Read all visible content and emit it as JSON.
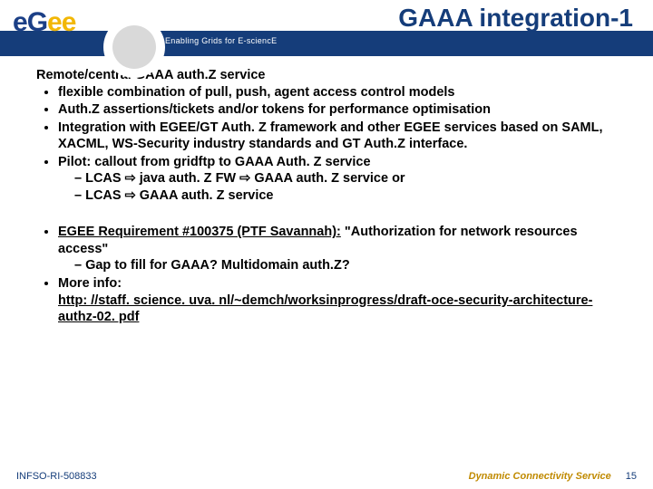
{
  "header": {
    "logo_e1": "e",
    "logo_g": "G",
    "logo_e2": "e",
    "logo_e3": "e",
    "tagline": "Enabling Grids for E-sciencE",
    "title": "GAAA integration-1"
  },
  "body": {
    "heading": "Remote/central GAAA auth.Z service",
    "bullets": [
      {
        "text": "flexible combination of pull, push, agent access control models"
      },
      {
        "text": "Auth.Z assertions/tickets and/or tokens for performance optimisation"
      },
      {
        "text": "Integration with EGEE/GT Auth. Z framework and other EGEE services based on SAML, XACML, WS-Security industry standards and GT Auth.Z interface."
      },
      {
        "lead": "Pilot: ",
        "rest": "callout from gridftp to GAAA Auth. Z service",
        "subs": [
          "LCAS ⇨ java auth. Z FW ⇨ GAAA auth. Z service or",
          "LCAS ⇨ GAAA auth. Z service"
        ]
      }
    ],
    "bullets2": [
      {
        "linktext": "EGEE Requirement #100375 (PTF Savannah):",
        "rest": " \"Authorization for network resources access\"",
        "subs": [
          "Gap to fill for GAAA? Multidomain auth.Z?"
        ]
      },
      {
        "lead": "More info: ",
        "url": "http: //staff. science. uva. nl/~demch/worksinprogress/draft-oce-security-architecture-authz-02. pdf"
      }
    ]
  },
  "footer": {
    "left": "INFSO-RI-508833",
    "right": "Dynamic Connectivity Service",
    "page": "15"
  }
}
